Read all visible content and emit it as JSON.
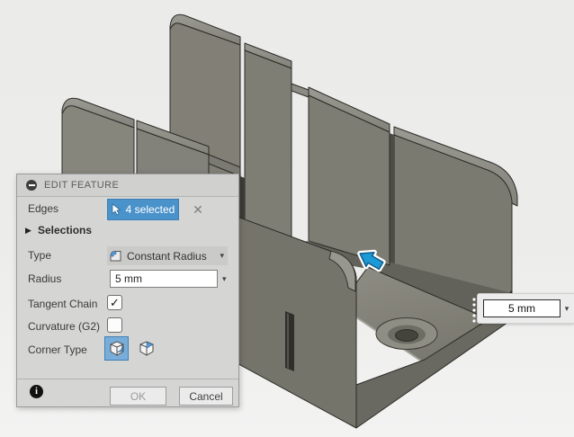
{
  "dialog": {
    "title": "EDIT FEATURE",
    "edges": {
      "label": "Edges",
      "count_label": "4 selected",
      "close_glyph": "✕"
    },
    "selections_label": "Selections",
    "type": {
      "label": "Type",
      "value": "Constant Radius"
    },
    "radius": {
      "label": "Radius",
      "value": "5 mm"
    },
    "tangent": {
      "label": "Tangent Chain",
      "checked": true,
      "check_glyph": "✓"
    },
    "curvature": {
      "label": "Curvature (G2)",
      "checked": false,
      "check_glyph": ""
    },
    "corner": {
      "label": "Corner Type",
      "selected_option": "rolling-ball"
    },
    "footer": {
      "ok": "OK",
      "cancel": "Cancel",
      "info_glyph": "i"
    }
  },
  "viewport": {
    "radius_manipulator": {
      "value": "5 mm"
    }
  },
  "icons": {
    "dropdown_glyph": "▾",
    "disclosure_glyph": "▶"
  },
  "colors": {
    "selection_blue": "#4a92ca",
    "manipulator_blue": "#1d9ad6",
    "model_face": "#7f7e75",
    "model_face_dark": "#696860",
    "model_bevel": "#929189",
    "dialog_bg": "#d5d5d4"
  }
}
